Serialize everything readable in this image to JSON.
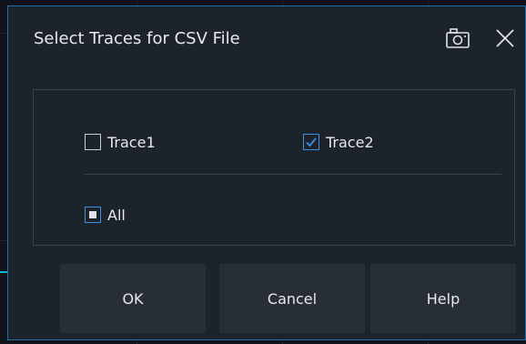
{
  "dialog": {
    "title": "Select Traces for CSV File",
    "icons": {
      "screenshot": "camera-icon",
      "close": "close-icon"
    },
    "options": [
      {
        "label": "Trace1",
        "state": "unchecked"
      },
      {
        "label": "Trace2",
        "state": "checked"
      }
    ],
    "all_option": {
      "label": "All",
      "state": "indeterminate"
    },
    "buttons": {
      "ok": "OK",
      "cancel": "Cancel",
      "help": "Help"
    }
  },
  "colors": {
    "accent": "#3a8ee6",
    "dialog_border": "#1f6fb0",
    "dialog_bg": "#1d232a",
    "button_bg": "#282e35",
    "trace_marker": "#00b7d4"
  }
}
